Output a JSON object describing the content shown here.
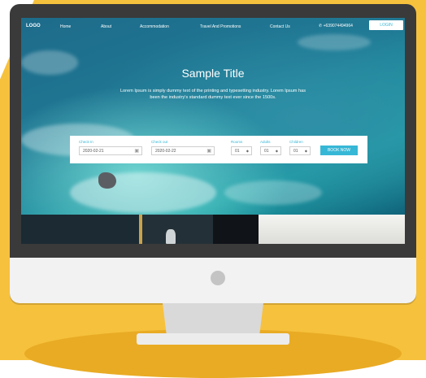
{
  "nav": {
    "logo": "LOGO",
    "items": [
      "Home",
      "About",
      "Accommodation",
      "Travel And Promotions",
      "Contact Us"
    ],
    "phone": "+639074494964",
    "login": "LOGIN"
  },
  "hero": {
    "title": "Sample Title",
    "subtitle": "Lorem Ipsum is simply dummy text of the printing and typesetting industry. Lorem Ipsum has been the industry's standard dummy text ever since the 1500s."
  },
  "booking": {
    "checkin_label": "Check In",
    "checkin_value": "2020-02-21",
    "checkout_label": "Check out",
    "checkout_value": "2020-02-22",
    "rooms_label": "Rooms",
    "rooms_value": "01",
    "adults_label": "Adults",
    "adults_value": "01",
    "children_label": "Children",
    "children_value": "01",
    "book_label": "BOOK NOW"
  },
  "colors": {
    "accent": "#37b7d6",
    "backdrop": "#f6c13d",
    "bezel": "#3a3a3a"
  }
}
